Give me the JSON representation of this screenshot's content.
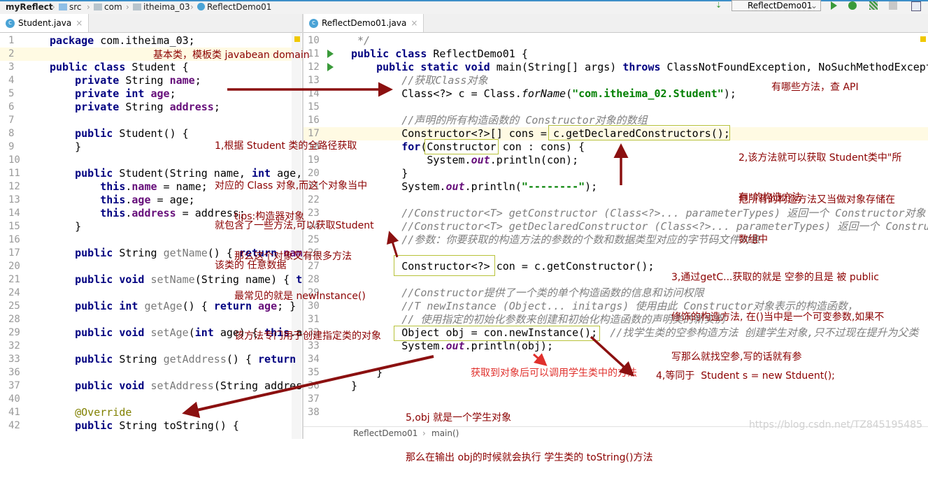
{
  "breadcrumb": [
    "myReflect",
    "src",
    "com",
    "itheima_03",
    "ReflectDemo01"
  ],
  "toolbar": {
    "run_config": "ReflectDemo01"
  },
  "colors": {
    "annotation": "#8b0000",
    "annotation_red": "#e0302c",
    "keyword": "#000080",
    "field": "#660e7a",
    "string": "#008000",
    "comment": "#808080",
    "box": "#b8c23a"
  },
  "left_tab": {
    "label": "Student.java",
    "icon": "class-icon"
  },
  "right_tab": {
    "label": "ReflectDemo01.java",
    "icon": "class-run-icon"
  },
  "left_editor": {
    "lines": [
      {
        "no": "1",
        "t": [
          [
            "k",
            "package"
          ],
          [
            "n",
            " com.itheima_03;"
          ]
        ]
      },
      {
        "no": "2",
        "t": []
      },
      {
        "no": "3",
        "t": [
          [
            "k",
            "public class"
          ],
          [
            "n",
            " Student {"
          ]
        ]
      },
      {
        "no": "4",
        "t": [
          [
            "n",
            "    "
          ],
          [
            "k",
            "private"
          ],
          [
            "n",
            " String "
          ],
          [
            "f",
            "name"
          ],
          [
            "n",
            ";"
          ]
        ]
      },
      {
        "no": "5",
        "t": [
          [
            "n",
            "    "
          ],
          [
            "k",
            "private int"
          ],
          [
            "n",
            " "
          ],
          [
            "f",
            "age"
          ],
          [
            "n",
            ";"
          ]
        ]
      },
      {
        "no": "6",
        "t": [
          [
            "n",
            "    "
          ],
          [
            "k",
            "private"
          ],
          [
            "n",
            " String "
          ],
          [
            "f",
            "address"
          ],
          [
            "n",
            ";"
          ]
        ]
      },
      {
        "no": "7",
        "t": []
      },
      {
        "no": "8",
        "t": [
          [
            "n",
            "    "
          ],
          [
            "k",
            "public"
          ],
          [
            "n",
            " Student() {"
          ]
        ]
      },
      {
        "no": "9",
        "t": [
          [
            "n",
            "    }"
          ]
        ]
      },
      {
        "no": "10",
        "t": []
      },
      {
        "no": "11",
        "t": [
          [
            "n",
            "    "
          ],
          [
            "k",
            "public"
          ],
          [
            "n",
            " Student(String name, "
          ],
          [
            "k",
            "int"
          ],
          [
            "n",
            " age,"
          ]
        ]
      },
      {
        "no": "12",
        "t": [
          [
            "n",
            "        "
          ],
          [
            "k",
            "this"
          ],
          [
            "n",
            "."
          ],
          [
            "f",
            "name"
          ],
          [
            "n",
            " = name;"
          ]
        ]
      },
      {
        "no": "13",
        "t": [
          [
            "n",
            "        "
          ],
          [
            "k",
            "this"
          ],
          [
            "n",
            "."
          ],
          [
            "f",
            "age"
          ],
          [
            "n",
            " = age;"
          ]
        ]
      },
      {
        "no": "14",
        "t": [
          [
            "n",
            "        "
          ],
          [
            "k",
            "this"
          ],
          [
            "n",
            "."
          ],
          [
            "f",
            "address"
          ],
          [
            "n",
            " = address;"
          ]
        ]
      },
      {
        "no": "15",
        "t": [
          [
            "n",
            "    }"
          ]
        ]
      },
      {
        "no": "16",
        "t": []
      },
      {
        "no": "17",
        "t": [
          [
            "n",
            "    "
          ],
          [
            "k",
            "public"
          ],
          [
            "n",
            " String "
          ],
          [
            "m",
            "getName"
          ],
          [
            "n",
            "() { "
          ],
          [
            "k",
            "return"
          ],
          [
            "n",
            " "
          ],
          [
            "f",
            "name"
          ]
        ]
      },
      {
        "no": "20",
        "t": []
      },
      {
        "no": "21",
        "t": [
          [
            "n",
            "    "
          ],
          [
            "k",
            "public void"
          ],
          [
            "n",
            " "
          ],
          [
            "m",
            "setName"
          ],
          [
            "n",
            "(String name) { "
          ],
          [
            "k",
            "th"
          ]
        ]
      },
      {
        "no": "24",
        "t": []
      },
      {
        "no": "25",
        "t": [
          [
            "n",
            "    "
          ],
          [
            "k",
            "public int"
          ],
          [
            "n",
            " "
          ],
          [
            "m",
            "getAge"
          ],
          [
            "n",
            "() { "
          ],
          [
            "k",
            "return"
          ],
          [
            "n",
            " "
          ],
          [
            "f",
            "age"
          ],
          [
            "n",
            "; }"
          ]
        ]
      },
      {
        "no": "28",
        "t": []
      },
      {
        "no": "29",
        "t": [
          [
            "n",
            "    "
          ],
          [
            "k",
            "public void"
          ],
          [
            "n",
            " "
          ],
          [
            "m",
            "setAge"
          ],
          [
            "n",
            "("
          ],
          [
            "k",
            "int"
          ],
          [
            "n",
            " age) { "
          ],
          [
            "k",
            "this"
          ],
          [
            "n",
            ".a"
          ]
        ]
      },
      {
        "no": "32",
        "t": []
      },
      {
        "no": "33",
        "t": [
          [
            "n",
            "    "
          ],
          [
            "k",
            "public"
          ],
          [
            "n",
            " String "
          ],
          [
            "m",
            "getAddress"
          ],
          [
            "n",
            "() { "
          ],
          [
            "k",
            "return"
          ]
        ]
      },
      {
        "no": "36",
        "t": []
      },
      {
        "no": "37",
        "t": [
          [
            "n",
            "    "
          ],
          [
            "k",
            "public void"
          ],
          [
            "n",
            " "
          ],
          [
            "m",
            "setAddress"
          ],
          [
            "n",
            "(String addres"
          ]
        ]
      },
      {
        "no": "40",
        "t": []
      },
      {
        "no": "41",
        "t": [
          [
            "n",
            "    "
          ],
          [
            "a",
            "@Override"
          ]
        ]
      },
      {
        "no": "42",
        "t": [
          [
            "n",
            "    "
          ],
          [
            "k",
            "public"
          ],
          [
            "n",
            " String "
          ],
          [
            "n",
            "toString() {"
          ]
        ]
      }
    ]
  },
  "right_editor": {
    "lines": [
      {
        "no": "10",
        "t": [
          [
            "c",
            " */"
          ]
        ]
      },
      {
        "no": "11",
        "t": [
          [
            "k",
            "public class"
          ],
          [
            "n",
            " ReflectDemo01 {"
          ]
        ]
      },
      {
        "no": "12",
        "t": [
          [
            "n",
            "    "
          ],
          [
            "k",
            "public static void"
          ],
          [
            "n",
            " main(String[] args) "
          ],
          [
            "k",
            "throws"
          ],
          [
            "n",
            " ClassNotFoundException, NoSuchMethodExcept"
          ]
        ]
      },
      {
        "no": "13",
        "t": [
          [
            "n",
            "        "
          ],
          [
            "c",
            "//获取Class对象"
          ]
        ]
      },
      {
        "no": "14",
        "t": [
          [
            "n",
            "        Class<?> c = Class."
          ],
          [
            "i",
            "forName"
          ],
          [
            "n",
            "("
          ],
          [
            "s",
            "\"com.itheima_02.Student\""
          ],
          [
            "n",
            ");"
          ]
        ]
      },
      {
        "no": "15",
        "t": []
      },
      {
        "no": "16",
        "t": [
          [
            "n",
            "        "
          ],
          [
            "c",
            "//声明的所有构造函数的 Constructor对象的数组"
          ]
        ]
      },
      {
        "no": "17",
        "t": [
          [
            "n",
            "        Constructor<?>[] cons = c.getDeclaredConstructors();"
          ]
        ]
      },
      {
        "no": "18",
        "t": [
          [
            "n",
            "        "
          ],
          [
            "k",
            "for"
          ],
          [
            "n",
            "(Constructor con : cons) {"
          ]
        ]
      },
      {
        "no": "19",
        "t": [
          [
            "n",
            "            System."
          ],
          [
            "o",
            "out"
          ],
          [
            "n",
            ".println(con);"
          ]
        ]
      },
      {
        "no": "20",
        "t": [
          [
            "n",
            "        }"
          ]
        ]
      },
      {
        "no": "21",
        "t": [
          [
            "n",
            "        System."
          ],
          [
            "o",
            "out"
          ],
          [
            "n",
            ".println("
          ],
          [
            "s",
            "\"--------\""
          ],
          [
            "n",
            ");"
          ]
        ]
      },
      {
        "no": "22",
        "t": []
      },
      {
        "no": "23",
        "t": [
          [
            "n",
            "        "
          ],
          [
            "c",
            "//Constructor<T> getConstructor (Class<?>... parameterTypes) 返回一个 Constructor对象"
          ]
        ]
      },
      {
        "no": "24",
        "t": [
          [
            "n",
            "        "
          ],
          [
            "c",
            "//Constructor<T> getDeclaredConstructor (Class<?>... parameterTypes) 返回一个 Constru"
          ]
        ]
      },
      {
        "no": "25",
        "t": [
          [
            "n",
            "        "
          ],
          [
            "c",
            "//参数：你要获取的构造方法的参数的个数和数据类型对应的字节码文件对象"
          ]
        ]
      },
      {
        "no": "26",
        "t": []
      },
      {
        "no": "27",
        "t": [
          [
            "n",
            "        Constructor<?> con = c.getConstructor();"
          ]
        ]
      },
      {
        "no": "28",
        "t": []
      },
      {
        "no": "29",
        "t": [
          [
            "n",
            "        "
          ],
          [
            "c",
            "//Constructor提供了一个类的单个构造函数的信息和访问权限"
          ]
        ]
      },
      {
        "no": "30",
        "t": [
          [
            "n",
            "        "
          ],
          [
            "c",
            "//T newInstance (Object... initargs) 使用由此 Constructor对象表示的构造函数，"
          ]
        ]
      },
      {
        "no": "31",
        "t": [
          [
            "n",
            "        "
          ],
          [
            "c",
            "// 使用指定的初始化参数来创建和初始化构造函数的声明类的新实例"
          ]
        ]
      },
      {
        "no": "32",
        "t": [
          [
            "n",
            "        Object obj = con.newInstance();  "
          ],
          [
            "c",
            "//找学生类的空参构造方法 创建学生对象,只不过现在提升为父类"
          ]
        ]
      },
      {
        "no": "33",
        "t": [
          [
            "n",
            "        System."
          ],
          [
            "o",
            "out"
          ],
          [
            "n",
            ".println(obj);"
          ]
        ]
      },
      {
        "no": "34",
        "t": []
      },
      {
        "no": "35",
        "t": [
          [
            "n",
            "    }"
          ]
        ]
      },
      {
        "no": "36",
        "t": [
          [
            "n",
            "}"
          ]
        ]
      },
      {
        "no": "37",
        "t": []
      },
      {
        "no": "38",
        "t": []
      }
    ]
  },
  "annotations": {
    "a0": "基本类，模板类 javabean domain",
    "a1": [
      "1,根据 Student 类的全路径获取",
      "对应的 Class 对象,而这个对象当中",
      "就包含了一些方法,可以获取Student",
      "该类的 任意数据"
    ],
    "tips": [
      "tips:构造器对象",
      "那么这个对象又有很多方法",
      "最常见的就是 newInstance()",
      "该方法专门用于创建指定类的对象"
    ],
    "api": "有哪些方法，查 API",
    "a2": [
      "2,该方法就可以获取 Student类中\"所",
      "有\"的构造方法"
    ],
    "a2b": [
      "把所有的构造方法又当做对象存储在",
      "数组中"
    ],
    "a3": [
      "3,通过getC...获取的就是 空参的且是 被 public",
      "修饰的构造方法, 在()当中是一个可变参数,如果不",
      "写那么就找空参,写的话就有参"
    ],
    "call": "获取到对象后可以调用学生类中的方法",
    "a4": "4,等同于  Student s = new Stduent();",
    "a5": [
      "5,obj 就是一个学生对象",
      "那么在输出 obj的时候就会执行 学生类的 toString()方法"
    ]
  },
  "status": {
    "crumb1": "ReflectDemo01",
    "crumb2": "main()"
  },
  "watermark": "https://blog.csdn.net/TZ845195485"
}
